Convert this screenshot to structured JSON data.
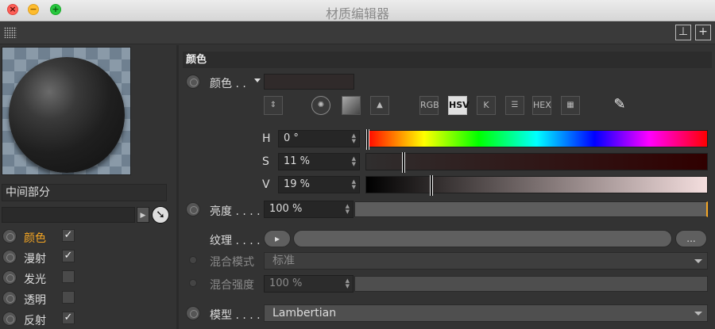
{
  "window": {
    "title": "材质编辑器"
  },
  "toolbar": {
    "grid_icon": "grid-icon",
    "lock_icon": "unlock-icon",
    "new_icon": "plus-box-icon"
  },
  "left": {
    "section_name": "中间部分",
    "channels": [
      {
        "label": "颜色",
        "checked": true,
        "active": true
      },
      {
        "label": "漫射",
        "checked": true,
        "active": false
      },
      {
        "label": "发光",
        "checked": false,
        "active": false
      },
      {
        "label": "透明",
        "checked": false,
        "active": false
      },
      {
        "label": "反射",
        "checked": true,
        "active": false
      }
    ]
  },
  "right": {
    "section_title": "颜色",
    "color_label": "颜色 . .",
    "color_swatch": "#302a2a",
    "mode_buttons": [
      "RGB",
      "HSV",
      "K",
      "HEX"
    ],
    "selected_mode": "HSV",
    "hsv": {
      "h_label": "H",
      "h_value": "0 °",
      "s_label": "S",
      "s_value": "11 %",
      "v_label": "V",
      "v_value": "19 %",
      "h_fraction": 0.0,
      "s_fraction": 0.11,
      "v_fraction": 0.19
    },
    "brightness_label": "亮度 . . . .",
    "brightness_value": "100 %",
    "texture_label": "纹理 . . . .",
    "texture_more": "...",
    "blend_mode_label": "混合模式",
    "blend_mode_value": "标准",
    "blend_strength_label": "混合强度",
    "blend_strength_value": "100 %",
    "model_label": "模型 . . . .",
    "model_value": "Lambertian"
  }
}
